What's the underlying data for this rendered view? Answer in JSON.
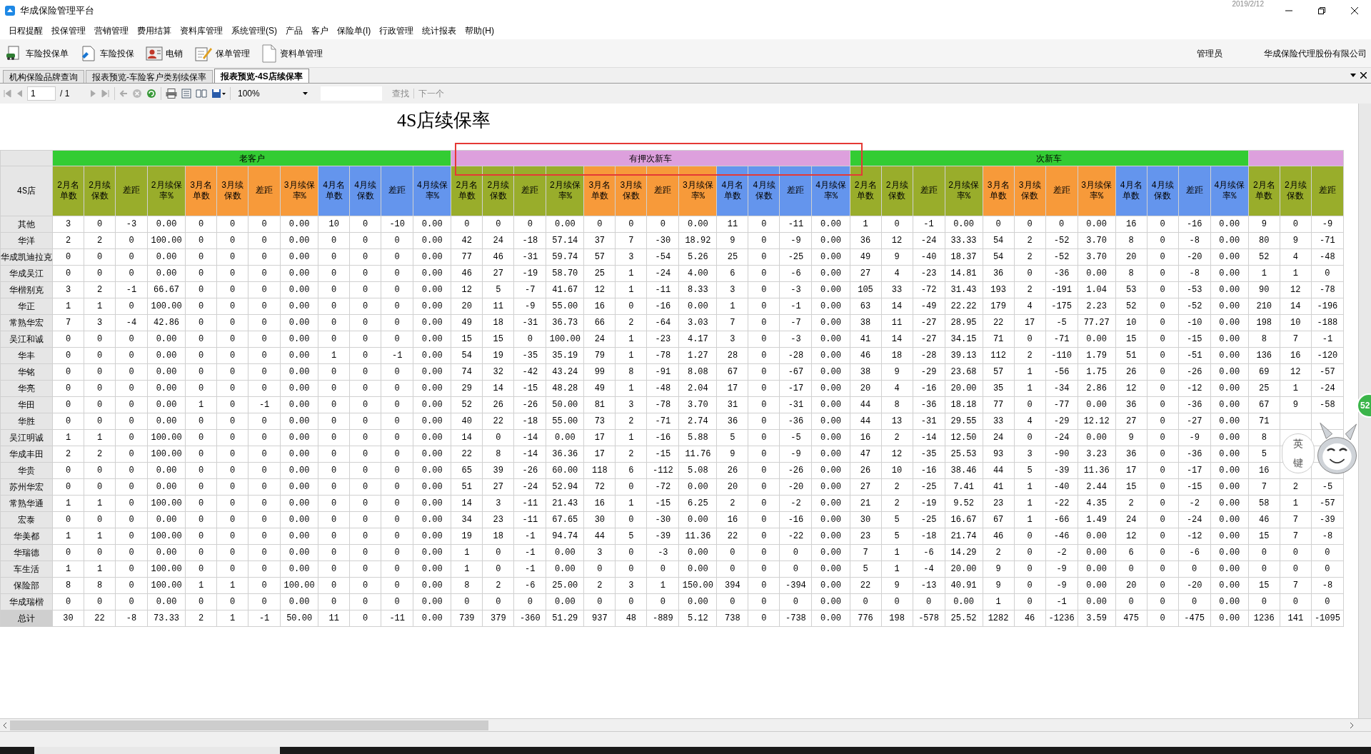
{
  "window": {
    "title": "华成保险管理平台",
    "clock": "2019/2/12"
  },
  "menu": [
    "日程提醒",
    "投保管理",
    "营销管理",
    "费用结算",
    "资料库管理",
    "系统管理(S)",
    "产品",
    "客户",
    "保险单(I)",
    "行政管理",
    "统计报表",
    "帮助(H)"
  ],
  "toolbar": {
    "buttons": [
      {
        "label": "车险投保单",
        "kind": "car"
      },
      {
        "label": "车险投保",
        "kind": "doc"
      },
      {
        "label": "电销",
        "kind": "person"
      },
      {
        "label": "保单管理",
        "kind": "pen"
      },
      {
        "label": "资料单管理",
        "kind": "page"
      }
    ],
    "user": "管理员",
    "company": "华成保险代理股份有限公司"
  },
  "tabs": [
    {
      "label": "机构保险品牌查询",
      "selected": false
    },
    {
      "label": "报表预览-车险客户类别续保率",
      "selected": false
    },
    {
      "label": "报表预览-4S店续保率",
      "selected": true
    }
  ],
  "viewer": {
    "page": "1",
    "page_total": "/ 1",
    "zoom": "100%",
    "find": "查找",
    "next": "下一个"
  },
  "report": {
    "title": "4S店续保率",
    "table": {
      "store_header": "4S店",
      "groups": [
        {
          "label": "老客户",
          "color": "#33cc33",
          "columns": [
            {
              "label": "2月名单数",
              "color": "#99ad2b"
            },
            {
              "label": "2月续保数",
              "color": "#99ad2b"
            },
            {
              "label": "差距",
              "color": "#99ad2b"
            },
            {
              "label": "2月续保率%",
              "color": "#99ad2b"
            },
            {
              "label": "3月名单数",
              "color": "#f79a3a"
            },
            {
              "label": "3月续保数",
              "color": "#f79a3a"
            },
            {
              "label": "差距",
              "color": "#f79a3a"
            },
            {
              "label": "3月续保率%",
              "color": "#f79a3a"
            },
            {
              "label": "4月名单数",
              "color": "#6495ed"
            },
            {
              "label": "4月续保数",
              "color": "#6495ed"
            },
            {
              "label": "差距",
              "color": "#6495ed"
            },
            {
              "label": "4月续保率%",
              "color": "#6495ed"
            }
          ]
        },
        {
          "label": "有押次新车",
          "color": "#dda0dd",
          "columns": [
            {
              "label": "2月名单数",
              "color": "#99ad2b"
            },
            {
              "label": "2月续保数",
              "color": "#99ad2b"
            },
            {
              "label": "差距",
              "color": "#99ad2b"
            },
            {
              "label": "2月续保率%",
              "color": "#99ad2b"
            },
            {
              "label": "3月名单数",
              "color": "#f79a3a"
            },
            {
              "label": "3月续保数",
              "color": "#f79a3a"
            },
            {
              "label": "差距",
              "color": "#f79a3a"
            },
            {
              "label": "3月续保率%",
              "color": "#f79a3a"
            },
            {
              "label": "4月名单数",
              "color": "#6495ed"
            },
            {
              "label": "4月续保数",
              "color": "#6495ed"
            },
            {
              "label": "差距",
              "color": "#6495ed"
            },
            {
              "label": "4月续保率%",
              "color": "#6495ed"
            }
          ]
        },
        {
          "label": "次新车",
          "color": "#33cc33",
          "columns": [
            {
              "label": "2月名单数",
              "color": "#99ad2b"
            },
            {
              "label": "2月续保数",
              "color": "#99ad2b"
            },
            {
              "label": "差距",
              "color": "#99ad2b"
            },
            {
              "label": "2月续保率%",
              "color": "#99ad2b"
            },
            {
              "label": "3月名单数",
              "color": "#f79a3a"
            },
            {
              "label": "3月续保数",
              "color": "#f79a3a"
            },
            {
              "label": "差距",
              "color": "#f79a3a"
            },
            {
              "label": "3月续保率%",
              "color": "#f79a3a"
            },
            {
              "label": "4月名单数",
              "color": "#6495ed"
            },
            {
              "label": "4月续保数",
              "color": "#6495ed"
            },
            {
              "label": "差距",
              "color": "#6495ed"
            },
            {
              "label": "4月续保率%",
              "color": "#6495ed"
            }
          ]
        },
        {
          "color": "#dda0dd",
          "columns": [
            {
              "label": "2月名单数",
              "color": "#99ad2b"
            },
            {
              "label": "2月续保数",
              "color": "#99ad2b"
            },
            {
              "label": "差距",
              "color": "#99ad2b"
            }
          ]
        }
      ],
      "rows": [
        {
          "store": "其他",
          "cells": [
            "3",
            "0",
            "-3",
            "0.00",
            "0",
            "0",
            "0",
            "0.00",
            "10",
            "0",
            "-10",
            "0.00",
            "0",
            "0",
            "0",
            "0.00",
            "0",
            "0",
            "0",
            "0.00",
            "11",
            "0",
            "-11",
            "0.00",
            "1",
            "0",
            "-1",
            "0.00",
            "0",
            "0",
            "0",
            "0.00",
            "16",
            "0",
            "-16",
            "0.00",
            "9",
            "0",
            "-9"
          ]
        },
        {
          "store": "华洋",
          "cells": [
            "2",
            "2",
            "0",
            "100.00",
            "0",
            "0",
            "0",
            "0.00",
            "0",
            "0",
            "0",
            "0.00",
            "42",
            "24",
            "-18",
            "57.14",
            "37",
            "7",
            "-30",
            "18.92",
            "9",
            "0",
            "-9",
            "0.00",
            "36",
            "12",
            "-24",
            "33.33",
            "54",
            "2",
            "-52",
            "3.70",
            "8",
            "0",
            "-8",
            "0.00",
            "80",
            "9",
            "-71"
          ]
        },
        {
          "store": "华成凯迪拉克",
          "cells": [
            "0",
            "0",
            "0",
            "0.00",
            "0",
            "0",
            "0",
            "0.00",
            "0",
            "0",
            "0",
            "0.00",
            "77",
            "46",
            "-31",
            "59.74",
            "57",
            "3",
            "-54",
            "5.26",
            "25",
            "0",
            "-25",
            "0.00",
            "49",
            "9",
            "-40",
            "18.37",
            "54",
            "2",
            "-52",
            "3.70",
            "20",
            "0",
            "-20",
            "0.00",
            "52",
            "4",
            "-48"
          ]
        },
        {
          "store": "华成吴江",
          "cells": [
            "0",
            "0",
            "0",
            "0.00",
            "0",
            "0",
            "0",
            "0.00",
            "0",
            "0",
            "0",
            "0.00",
            "46",
            "27",
            "-19",
            "58.70",
            "25",
            "1",
            "-24",
            "4.00",
            "6",
            "0",
            "-6",
            "0.00",
            "27",
            "4",
            "-23",
            "14.81",
            "36",
            "0",
            "-36",
            "0.00",
            "8",
            "0",
            "-8",
            "0.00",
            "1",
            "1",
            "0"
          ]
        },
        {
          "store": "华楷别克",
          "cells": [
            "3",
            "2",
            "-1",
            "66.67",
            "0",
            "0",
            "0",
            "0.00",
            "0",
            "0",
            "0",
            "0.00",
            "12",
            "5",
            "-7",
            "41.67",
            "12",
            "1",
            "-11",
            "8.33",
            "3",
            "0",
            "-3",
            "0.00",
            "105",
            "33",
            "-72",
            "31.43",
            "193",
            "2",
            "-191",
            "1.04",
            "53",
            "0",
            "-53",
            "0.00",
            "90",
            "12",
            "-78"
          ]
        },
        {
          "store": "华正",
          "cells": [
            "1",
            "1",
            "0",
            "100.00",
            "0",
            "0",
            "0",
            "0.00",
            "0",
            "0",
            "0",
            "0.00",
            "20",
            "11",
            "-9",
            "55.00",
            "16",
            "0",
            "-16",
            "0.00",
            "1",
            "0",
            "-1",
            "0.00",
            "63",
            "14",
            "-49",
            "22.22",
            "179",
            "4",
            "-175",
            "2.23",
            "52",
            "0",
            "-52",
            "0.00",
            "210",
            "14",
            "-196"
          ]
        },
        {
          "store": "常熟华宏",
          "cells": [
            "7",
            "3",
            "-4",
            "42.86",
            "0",
            "0",
            "0",
            "0.00",
            "0",
            "0",
            "0",
            "0.00",
            "49",
            "18",
            "-31",
            "36.73",
            "66",
            "2",
            "-64",
            "3.03",
            "7",
            "0",
            "-7",
            "0.00",
            "38",
            "11",
            "-27",
            "28.95",
            "22",
            "17",
            "-5",
            "77.27",
            "10",
            "0",
            "-10",
            "0.00",
            "198",
            "10",
            "-188"
          ]
        },
        {
          "store": "吴江和诚",
          "cells": [
            "0",
            "0",
            "0",
            "0.00",
            "0",
            "0",
            "0",
            "0.00",
            "0",
            "0",
            "0",
            "0.00",
            "15",
            "15",
            "0",
            "100.00",
            "24",
            "1",
            "-23",
            "4.17",
            "3",
            "0",
            "-3",
            "0.00",
            "41",
            "14",
            "-27",
            "34.15",
            "71",
            "0",
            "-71",
            "0.00",
            "15",
            "0",
            "-15",
            "0.00",
            "8",
            "7",
            "-1"
          ]
        },
        {
          "store": "华丰",
          "cells": [
            "0",
            "0",
            "0",
            "0.00",
            "0",
            "0",
            "0",
            "0.00",
            "1",
            "0",
            "-1",
            "0.00",
            "54",
            "19",
            "-35",
            "35.19",
            "79",
            "1",
            "-78",
            "1.27",
            "28",
            "0",
            "-28",
            "0.00",
            "46",
            "18",
            "-28",
            "39.13",
            "112",
            "2",
            "-110",
            "1.79",
            "51",
            "0",
            "-51",
            "0.00",
            "136",
            "16",
            "-120"
          ]
        },
        {
          "store": "华铭",
          "cells": [
            "0",
            "0",
            "0",
            "0.00",
            "0",
            "0",
            "0",
            "0.00",
            "0",
            "0",
            "0",
            "0.00",
            "74",
            "32",
            "-42",
            "43.24",
            "99",
            "8",
            "-91",
            "8.08",
            "67",
            "0",
            "-67",
            "0.00",
            "38",
            "9",
            "-29",
            "23.68",
            "57",
            "1",
            "-56",
            "1.75",
            "26",
            "0",
            "-26",
            "0.00",
            "69",
            "12",
            "-57"
          ]
        },
        {
          "store": "华亮",
          "cells": [
            "0",
            "0",
            "0",
            "0.00",
            "0",
            "0",
            "0",
            "0.00",
            "0",
            "0",
            "0",
            "0.00",
            "29",
            "14",
            "-15",
            "48.28",
            "49",
            "1",
            "-48",
            "2.04",
            "17",
            "0",
            "-17",
            "0.00",
            "20",
            "4",
            "-16",
            "20.00",
            "35",
            "1",
            "-34",
            "2.86",
            "12",
            "0",
            "-12",
            "0.00",
            "25",
            "1",
            "-24"
          ]
        },
        {
          "store": "华田",
          "cells": [
            "0",
            "0",
            "0",
            "0.00",
            "1",
            "0",
            "-1",
            "0.00",
            "0",
            "0",
            "0",
            "0.00",
            "52",
            "26",
            "-26",
            "50.00",
            "81",
            "3",
            "-78",
            "3.70",
            "31",
            "0",
            "-31",
            "0.00",
            "44",
            "8",
            "-36",
            "18.18",
            "77",
            "0",
            "-77",
            "0.00",
            "36",
            "0",
            "-36",
            "0.00",
            "67",
            "9",
            "-58"
          ]
        },
        {
          "store": "华胜",
          "cells": [
            "0",
            "0",
            "0",
            "0.00",
            "0",
            "0",
            "0",
            "0.00",
            "0",
            "0",
            "0",
            "0.00",
            "40",
            "22",
            "-18",
            "55.00",
            "73",
            "2",
            "-71",
            "2.74",
            "36",
            "0",
            "-36",
            "0.00",
            "44",
            "13",
            "-31",
            "29.55",
            "33",
            "4",
            "-29",
            "12.12",
            "27",
            "0",
            "-27",
            "0.00",
            "71",
            null,
            null
          ]
        },
        {
          "store": "吴江明诚",
          "cells": [
            "1",
            "1",
            "0",
            "100.00",
            "0",
            "0",
            "0",
            "0.00",
            "0",
            "0",
            "0",
            "0.00",
            "14",
            "0",
            "-14",
            "0.00",
            "17",
            "1",
            "-16",
            "5.88",
            "5",
            "0",
            "-5",
            "0.00",
            "16",
            "2",
            "-14",
            "12.50",
            "24",
            "0",
            "-24",
            "0.00",
            "9",
            "0",
            "-9",
            "0.00",
            "8",
            null,
            null
          ]
        },
        {
          "store": "华成丰田",
          "cells": [
            "2",
            "2",
            "0",
            "100.00",
            "0",
            "0",
            "0",
            "0.00",
            "0",
            "0",
            "0",
            "0.00",
            "22",
            "8",
            "-14",
            "36.36",
            "17",
            "2",
            "-15",
            "11.76",
            "9",
            "0",
            "-9",
            "0.00",
            "47",
            "12",
            "-35",
            "25.53",
            "93",
            "3",
            "-90",
            "3.23",
            "36",
            "0",
            "-36",
            "0.00",
            "5",
            null,
            null
          ]
        },
        {
          "store": "华贵",
          "cells": [
            "0",
            "0",
            "0",
            "0.00",
            "0",
            "0",
            "0",
            "0.00",
            "0",
            "0",
            "0",
            "0.00",
            "65",
            "39",
            "-26",
            "60.00",
            "118",
            "6",
            "-112",
            "5.08",
            "26",
            "0",
            "-26",
            "0.00",
            "26",
            "10",
            "-16",
            "38.46",
            "44",
            "5",
            "-39",
            "11.36",
            "17",
            "0",
            "-17",
            "0.00",
            "16",
            null,
            null
          ]
        },
        {
          "store": "苏州华宏",
          "cells": [
            "0",
            "0",
            "0",
            "0.00",
            "0",
            "0",
            "0",
            "0.00",
            "0",
            "0",
            "0",
            "0.00",
            "51",
            "27",
            "-24",
            "52.94",
            "72",
            "0",
            "-72",
            "0.00",
            "20",
            "0",
            "-20",
            "0.00",
            "27",
            "2",
            "-25",
            "7.41",
            "41",
            "1",
            "-40",
            "2.44",
            "15",
            "0",
            "-15",
            "0.00",
            "7",
            "2",
            "-5"
          ]
        },
        {
          "store": "常熟华通",
          "cells": [
            "1",
            "1",
            "0",
            "100.00",
            "0",
            "0",
            "0",
            "0.00",
            "0",
            "0",
            "0",
            "0.00",
            "14",
            "3",
            "-11",
            "21.43",
            "16",
            "1",
            "-15",
            "6.25",
            "2",
            "0",
            "-2",
            "0.00",
            "21",
            "2",
            "-19",
            "9.52",
            "23",
            "1",
            "-22",
            "4.35",
            "2",
            "0",
            "-2",
            "0.00",
            "58",
            "1",
            "-57"
          ]
        },
        {
          "store": "宏泰",
          "cells": [
            "0",
            "0",
            "0",
            "0.00",
            "0",
            "0",
            "0",
            "0.00",
            "0",
            "0",
            "0",
            "0.00",
            "34",
            "23",
            "-11",
            "67.65",
            "30",
            "0",
            "-30",
            "0.00",
            "16",
            "0",
            "-16",
            "0.00",
            "30",
            "5",
            "-25",
            "16.67",
            "67",
            "1",
            "-66",
            "1.49",
            "24",
            "0",
            "-24",
            "0.00",
            "46",
            "7",
            "-39"
          ]
        },
        {
          "store": "华美都",
          "cells": [
            "1",
            "1",
            "0",
            "100.00",
            "0",
            "0",
            "0",
            "0.00",
            "0",
            "0",
            "0",
            "0.00",
            "19",
            "18",
            "-1",
            "94.74",
            "44",
            "5",
            "-39",
            "11.36",
            "22",
            "0",
            "-22",
            "0.00",
            "23",
            "5",
            "-18",
            "21.74",
            "46",
            "0",
            "-46",
            "0.00",
            "12",
            "0",
            "-12",
            "0.00",
            "15",
            "7",
            "-8"
          ]
        },
        {
          "store": "华瑞德",
          "cells": [
            "0",
            "0",
            "0",
            "0.00",
            "0",
            "0",
            "0",
            "0.00",
            "0",
            "0",
            "0",
            "0.00",
            "1",
            "0",
            "-1",
            "0.00",
            "3",
            "0",
            "-3",
            "0.00",
            "0",
            "0",
            "0",
            "0.00",
            "7",
            "1",
            "-6",
            "14.29",
            "2",
            "0",
            "-2",
            "0.00",
            "6",
            "0",
            "-6",
            "0.00",
            "0",
            "0",
            "0"
          ]
        },
        {
          "store": "车生活",
          "cells": [
            "1",
            "1",
            "0",
            "100.00",
            "0",
            "0",
            "0",
            "0.00",
            "0",
            "0",
            "0",
            "0.00",
            "1",
            "0",
            "-1",
            "0.00",
            "0",
            "0",
            "0",
            "0.00",
            "0",
            "0",
            "0",
            "0.00",
            "5",
            "1",
            "-4",
            "20.00",
            "9",
            "0",
            "-9",
            "0.00",
            "0",
            "0",
            "0",
            "0.00",
            "0",
            "0",
            "0"
          ]
        },
        {
          "store": "保险部",
          "cells": [
            "8",
            "8",
            "0",
            "100.00",
            "1",
            "1",
            "0",
            "100.00",
            "0",
            "0",
            "0",
            "0.00",
            "8",
            "2",
            "-6",
            "25.00",
            "2",
            "3",
            "1",
            "150.00",
            "394",
            "0",
            "-394",
            "0.00",
            "22",
            "9",
            "-13",
            "40.91",
            "9",
            "0",
            "-9",
            "0.00",
            "20",
            "0",
            "-20",
            "0.00",
            "15",
            "7",
            "-8"
          ]
        },
        {
          "store": "华成瑞楷",
          "cells": [
            "0",
            "0",
            "0",
            "0.00",
            "0",
            "0",
            "0",
            "0.00",
            "0",
            "0",
            "0",
            "0.00",
            "0",
            "0",
            "0",
            "0.00",
            "0",
            "0",
            "0",
            "0.00",
            "0",
            "0",
            "0",
            "0.00",
            "0",
            "0",
            "0",
            "0.00",
            "1",
            "0",
            "-1",
            "0.00",
            "0",
            "0",
            "0",
            "0.00",
            "0",
            "0",
            "0"
          ]
        }
      ],
      "total": {
        "store": "总计",
        "cells": [
          "30",
          "22",
          "-8",
          "73.33",
          "2",
          "1",
          "-1",
          "50.00",
          "11",
          "0",
          "-11",
          "0.00",
          "739",
          "379",
          "-360",
          "51.29",
          "937",
          "48",
          "-889",
          "5.12",
          "738",
          "0",
          "-738",
          "0.00",
          "776",
          "198",
          "-578",
          "25.52",
          "1282",
          "46",
          "-1236",
          "3.59",
          "475",
          "0",
          "-475",
          "0.00",
          "1236",
          "141",
          "-1095"
        ]
      }
    }
  },
  "floating_widget": {
    "badge": "52",
    "bubble": [
      "英",
      "键"
    ]
  }
}
